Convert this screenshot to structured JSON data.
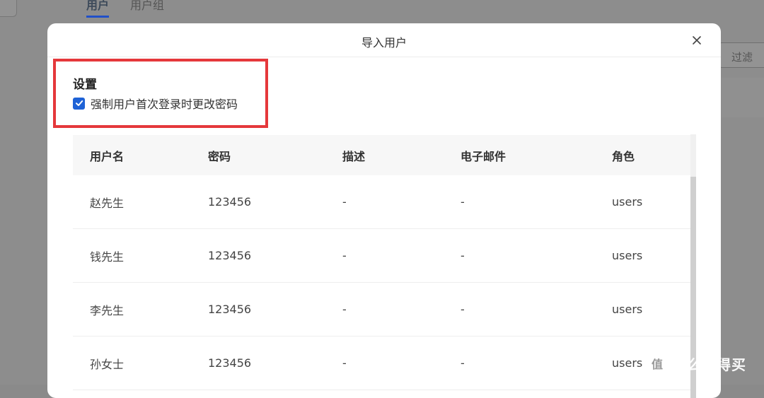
{
  "background": {
    "tabs": [
      "用户",
      "用户组"
    ],
    "filter_label": "过滤"
  },
  "modal": {
    "title": "导入用户",
    "settings": {
      "title": "设置",
      "force_change_password_label": "强制用户首次登录时更改密码",
      "force_change_password_checked": true
    },
    "table": {
      "columns": [
        "用户名",
        "密码",
        "描述",
        "电子邮件",
        "角色"
      ],
      "rows": [
        [
          "赵先生",
          "123456",
          "-",
          "-",
          "users"
        ],
        [
          "钱先生",
          "123456",
          "-",
          "-",
          "users"
        ],
        [
          "李先生",
          "123456",
          "-",
          "-",
          "users"
        ],
        [
          "孙女士",
          "123456",
          "-",
          "-",
          "users"
        ]
      ]
    }
  },
  "watermark": {
    "text": "什么值得买",
    "logo": "值"
  },
  "colors": {
    "accent": "#1e62d6",
    "highlight_border": "#e5383b"
  }
}
